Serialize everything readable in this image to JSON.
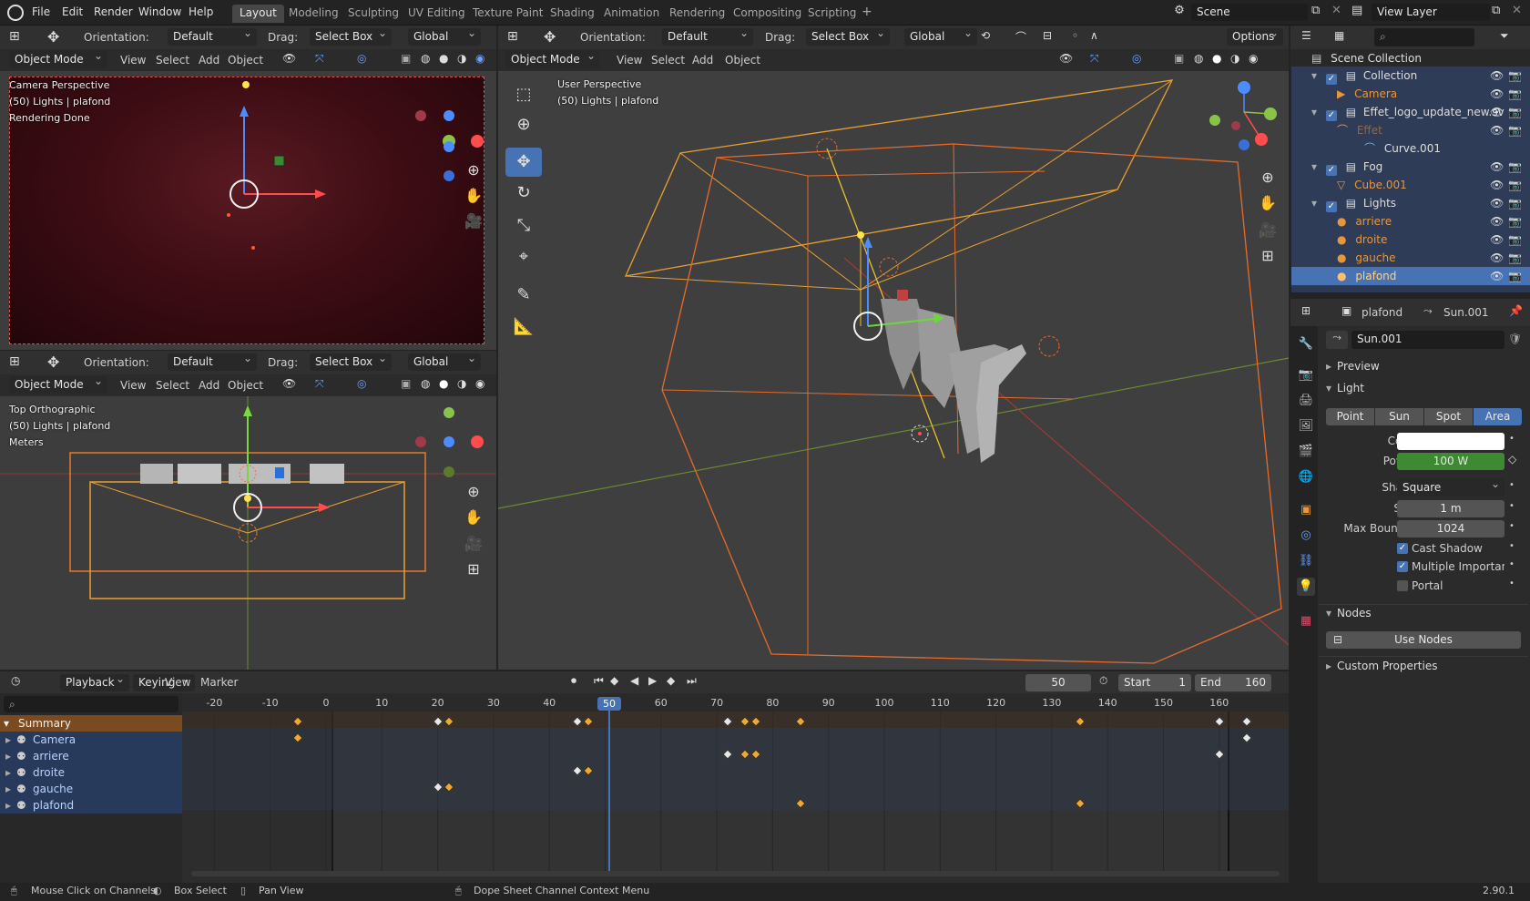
{
  "menu": [
    "File",
    "Edit",
    "Render",
    "Window",
    "Help"
  ],
  "workspaces": [
    "Layout",
    "Modeling",
    "Sculpting",
    "UV Editing",
    "Texture Paint",
    "Shading",
    "Animation",
    "Rendering",
    "Compositing",
    "Scripting"
  ],
  "scene": "Scene",
  "view_layer": "View Layer",
  "vp_header": {
    "orientation_label": "Orientation:",
    "orientation": "Default",
    "drag_label": "Drag:",
    "drag": "Select Box",
    "transform": "Global",
    "options": "Options",
    "mode": "Object Mode",
    "view": "View",
    "select": "Select",
    "add": "Add",
    "object": "Object"
  },
  "viewport_camera": {
    "line1": "Camera Perspective",
    "line2": "(50) Lights | plafond",
    "line3": "Rendering Done"
  },
  "viewport_top": {
    "line1": "Top Orthographic",
    "line2": "(50) Lights | plafond",
    "line3": "Meters"
  },
  "viewport_user": {
    "line1": "User Perspective",
    "line2": "(50) Lights | plafond"
  },
  "outliner": {
    "root": "Scene Collection",
    "rows": [
      {
        "label": "Collection"
      },
      {
        "label": "Camera"
      },
      {
        "label": "Effet_logo_update_new.sv"
      },
      {
        "label": "Effet"
      },
      {
        "label": "Curve.001"
      },
      {
        "label": "Fog"
      },
      {
        "label": "Cube.001"
      },
      {
        "label": "Lights"
      },
      {
        "label": "arriere"
      },
      {
        "label": "droite"
      },
      {
        "label": "gauche"
      },
      {
        "label": "plafond"
      }
    ]
  },
  "properties": {
    "object_name": "plafond",
    "data_name": "Sun.001",
    "datablock": "Sun.001",
    "preview": "Preview",
    "light": "Light",
    "types": [
      "Point",
      "Sun",
      "Spot",
      "Area"
    ],
    "active_type": "Area",
    "color_label": "Color",
    "color_value": "#ffffff",
    "power_label": "Power",
    "power": "100 W",
    "shape_label": "Shape",
    "shape": "Square",
    "size_label": "Size",
    "size": "1 m",
    "bounces_label": "Max Bounces",
    "bounces": "1024",
    "cast_shadow": "Cast Shadow",
    "multiple_importance": "Multiple Importan...",
    "portal": "Portal",
    "nodes": "Nodes",
    "use_nodes": "Use Nodes",
    "custom_props": "Custom Properties"
  },
  "timeline": {
    "playback": "Playback",
    "keying": "Keying",
    "view": "View",
    "marker": "Marker",
    "current_frame": "50",
    "start_label": "Start",
    "start": "1",
    "end_label": "End",
    "end": "160",
    "ticks": [
      "-20",
      "-10",
      "0",
      "10",
      "20",
      "30",
      "40",
      "50",
      "60",
      "70",
      "80",
      "90",
      "100",
      "110",
      "120",
      "130",
      "140",
      "150",
      "160"
    ],
    "channels": [
      {
        "label": "Summary"
      },
      {
        "label": "Camera"
      },
      {
        "label": "arriere"
      },
      {
        "label": "droite"
      },
      {
        "label": "gauche"
      },
      {
        "label": "plafond"
      }
    ],
    "keyframes": {
      "summary": [
        -5,
        20,
        22,
        45,
        47,
        72,
        75,
        77,
        85,
        135,
        160,
        165
      ],
      "camera": [
        -5,
        165
      ],
      "arriere": [
        72,
        75,
        77,
        160
      ],
      "droite": [
        45,
        47
      ],
      "gauche": [
        20,
        22
      ],
      "plafond": [
        85,
        135
      ]
    }
  },
  "status": {
    "left": "Mouse Click on Channels",
    "box": "Box Select",
    "pan": "Pan View",
    "ctx": "Dope Sheet Channel Context Menu",
    "version": "2.90.1"
  },
  "colors": {
    "accent": "#4772b3",
    "selection": "#334d80",
    "orange_key": "#f0a830",
    "power_green": "#3e8a32"
  }
}
